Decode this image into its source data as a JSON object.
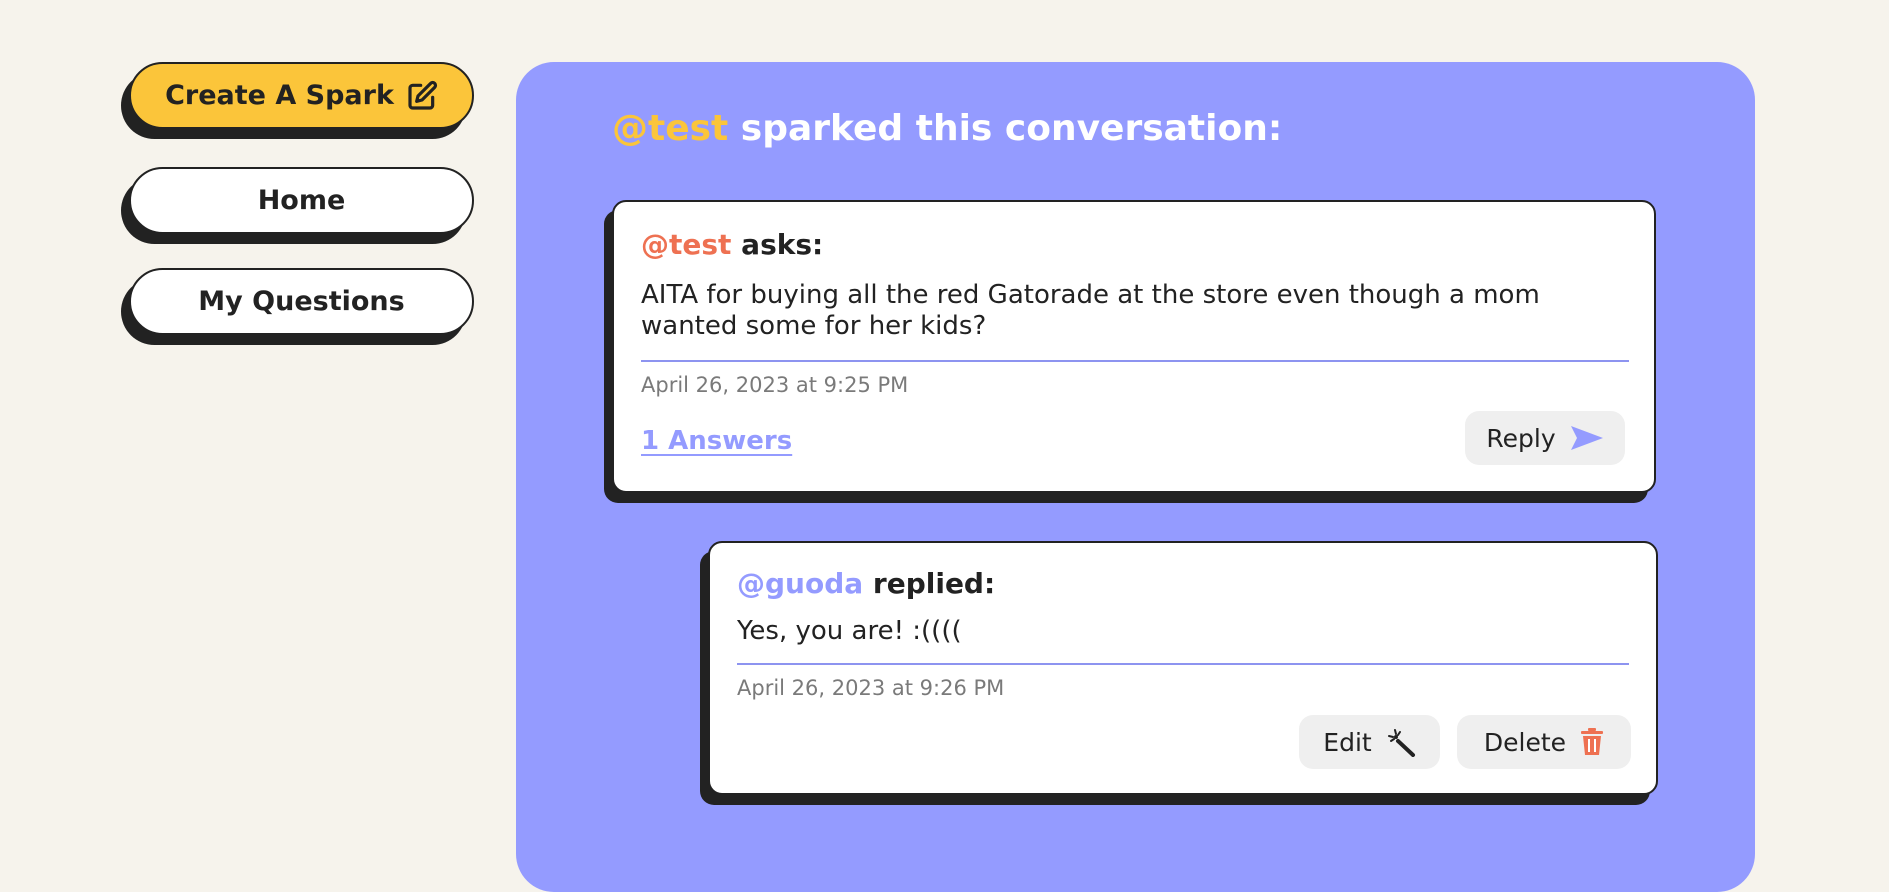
{
  "sidebar": {
    "create_label": "Create A Spark",
    "home_label": "Home",
    "my_questions_label": "My Questions"
  },
  "panel": {
    "title_user": "@test",
    "title_rest": " sparked this conversation:"
  },
  "question": {
    "user": "@test",
    "verb": " asks:",
    "text": "AITA for buying all the red Gatorade at the store even though a mom wanted some for her kids?",
    "timestamp": "April 26, 2023 at 9:25 PM",
    "answers_label": "1 Answers",
    "reply_label": "Reply"
  },
  "reply": {
    "user": "@guoda",
    "verb": " replied:",
    "text": "Yes, you are! :((((",
    "timestamp": "April 26, 2023 at 9:26 PM",
    "edit_label": "Edit",
    "delete_label": "Delete"
  },
  "colors": {
    "background": "#f6f3ec",
    "panel": "#949bff",
    "accent_yellow": "#fbc53a",
    "accent_orange": "#ee7152",
    "text_dark": "#222222"
  },
  "icons": {
    "create": "edit-square-icon",
    "reply": "send-icon",
    "edit": "magic-wand-icon",
    "delete": "trash-icon"
  }
}
